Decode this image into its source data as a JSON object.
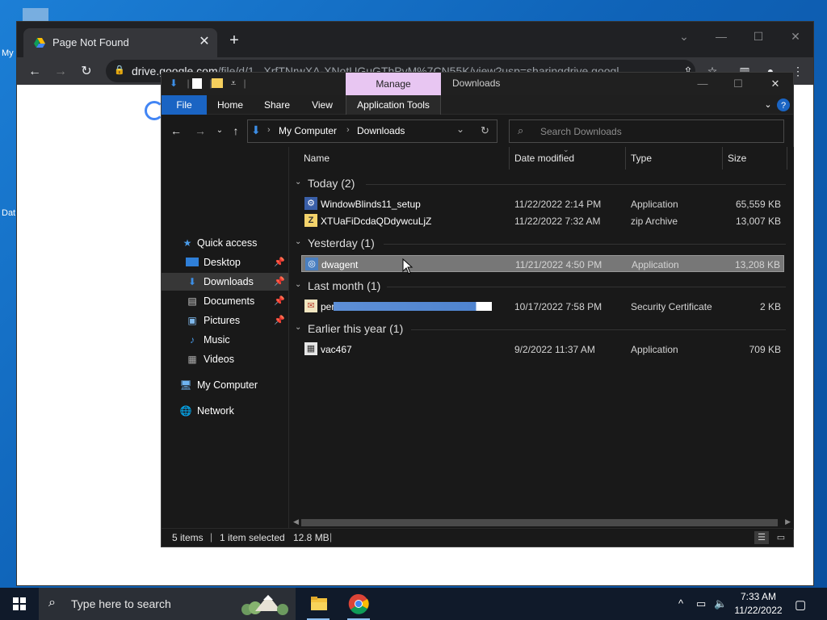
{
  "desktop": {
    "icon_label_1": "My",
    "icon_label_2": "Dat"
  },
  "browser": {
    "tab_title": "Page Not Found",
    "tab_close": "✕",
    "new_tab": "+",
    "url_host": "drive.google.com",
    "url_path": "/file/d/1...XrfTNrwXA-XNotUGuGThPvM%7CN55K/view?usp=sharingdrive.googl",
    "window_controls": {
      "minimize": "—",
      "maximize": "☐",
      "close": "✕",
      "tablist": "⌄"
    }
  },
  "explorer": {
    "title": "Downloads",
    "contextual_tab": "Manage",
    "ribbon_tabs": [
      "File",
      "Home",
      "Share",
      "View",
      "Application Tools"
    ],
    "breadcrumb": [
      "My Computer",
      "Downloads"
    ],
    "search_placeholder": "Search Downloads",
    "columns": {
      "name": "Name",
      "date": "Date modified",
      "type": "Type",
      "size": "Size"
    },
    "nav": {
      "quick_access": "Quick access",
      "desktop": "Desktop",
      "downloads": "Downloads",
      "documents": "Documents",
      "pictures": "Pictures",
      "music": "Music",
      "videos": "Videos",
      "my_computer": "My Computer",
      "network": "Network"
    },
    "groups": [
      {
        "label": "Today (2)"
      },
      {
        "label": "Yesterday (1)"
      },
      {
        "label": "Last month (1)"
      },
      {
        "label": "Earlier this year (1)"
      }
    ],
    "files": [
      {
        "name": "WindowBlinds11_setup",
        "date": "11/22/2022 2:14 PM",
        "type": "Application",
        "size": "65,559 KB"
      },
      {
        "name": "XTUaFiDcdaQDdywcuLjZ",
        "date": "11/22/2022 7:32 AM",
        "type": "zip Archive",
        "size": "13,007 KB"
      },
      {
        "name": "dwagent",
        "date": "11/21/2022 4:50 PM",
        "type": "Application",
        "size": "13,208 KB"
      },
      {
        "name": "per",
        "date": "10/17/2022 7:58 PM",
        "type": "Security Certificate",
        "size": "2 KB"
      },
      {
        "name": "vac467",
        "date": "9/2/2022 11:37 AM",
        "type": "Application",
        "size": "709 KB"
      }
    ],
    "status": {
      "items": "5 items",
      "selected": "1 item selected",
      "size": "12.8 MB"
    }
  },
  "taskbar": {
    "search_text": "Type here to search",
    "time": "7:33 AM",
    "date": "11/22/2022"
  },
  "colors": {
    "accent": "#1a64c3",
    "manage_tab": "#e8c6f2",
    "selection": "#777777"
  }
}
